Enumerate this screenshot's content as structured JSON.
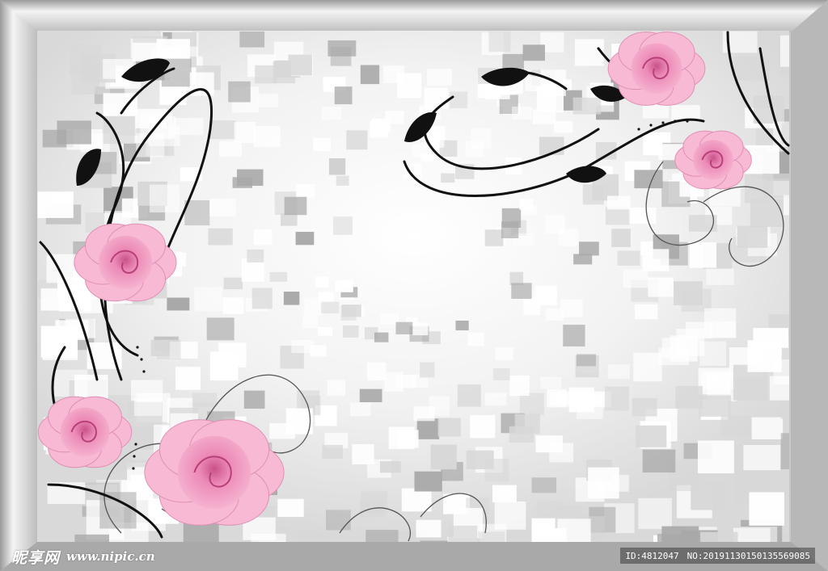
{
  "image": {
    "subject": "wallpaper-style artwork: grey 3D cube tunnel inside a silver frame, pink roses with black and grey swirl vines",
    "colors": {
      "frame": "#c9c9c9",
      "frame_light": "#f4f4f4",
      "frame_dark": "#9a9a9a",
      "background": "#ededed",
      "cube_light": "#ffffff",
      "cube_mid": "#d8d8d8",
      "cube_dark": "#a9a9a9",
      "rose_light": "#f7b9d4",
      "rose_mid": "#ec8ab6",
      "rose_dark": "#c9528a",
      "vine": "#111111",
      "swirl": "#555555"
    }
  },
  "watermark": {
    "logo_cn": "昵享网",
    "url": "www.nipic.cn",
    "id_text": "ID:4812047",
    "no_text": "NO:20191130150135569085"
  }
}
